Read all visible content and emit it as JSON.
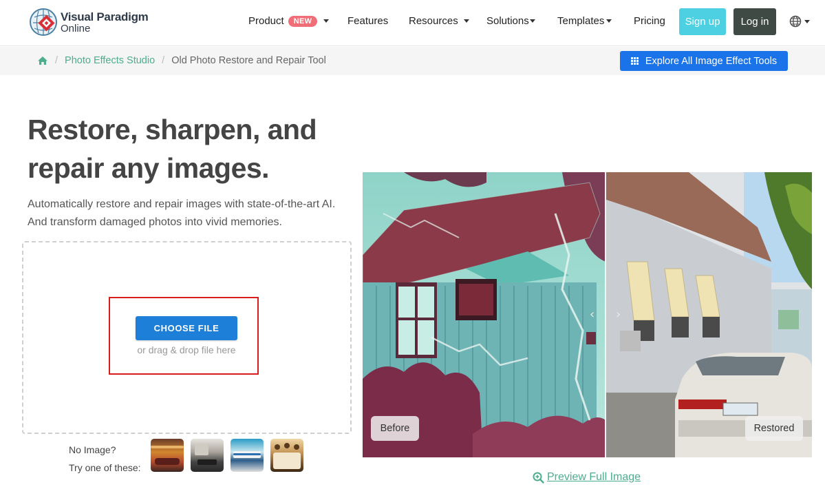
{
  "brand": {
    "name_line1": "Visual Paradigm",
    "name_line2": "Online"
  },
  "nav": {
    "items": [
      {
        "label": "Product",
        "badge": "NEW",
        "dropdown": true
      },
      {
        "label": "Features",
        "dropdown": false
      },
      {
        "label": "Resources",
        "dropdown": true
      },
      {
        "label": "Solutions",
        "dropdown": true
      },
      {
        "label": "Templates",
        "dropdown": true
      },
      {
        "label": "Pricing",
        "dropdown": false
      }
    ],
    "signup_label": "Sign up",
    "login_label": "Log in",
    "language_icon": "globe-icon"
  },
  "breadcrumb": {
    "home_icon": "home-icon",
    "items": [
      "Photo Effects Studio",
      "Old Photo Restore and Repair Tool"
    ]
  },
  "explore_button": {
    "label": "Explore All Image Effect Tools",
    "icon": "grid-icon"
  },
  "hero": {
    "headline_line1": "Restore, sharpen, and",
    "headline_line2": "repair any images.",
    "subtext": "Automatically restore and repair images with state-of-the-art AI. And transform damaged photos into vivid memories."
  },
  "upload": {
    "choose_label": "CHOOSE FILE",
    "drag_text": "or drag & drop file here"
  },
  "samples": {
    "line1": "No Image?",
    "line2": "Try one of these:",
    "thumbnails": [
      "sample-car-sunset",
      "sample-interior",
      "sample-train",
      "sample-group-photo"
    ]
  },
  "comparison": {
    "before_label": "Before",
    "after_label": "Restored",
    "prev_icon": "chevron-left-icon",
    "next_icon": "chevron-right-icon"
  },
  "preview_link": {
    "label": "Preview Full Image",
    "icon": "zoom-in-icon"
  },
  "colors": {
    "accent_green": "#4cae8c",
    "primary_blue": "#1a73e8",
    "signup_cyan": "#4dd0e1",
    "login_dark": "#404a44",
    "badge_red": "#ef6e78",
    "highlight_red": "#d81b1b"
  }
}
